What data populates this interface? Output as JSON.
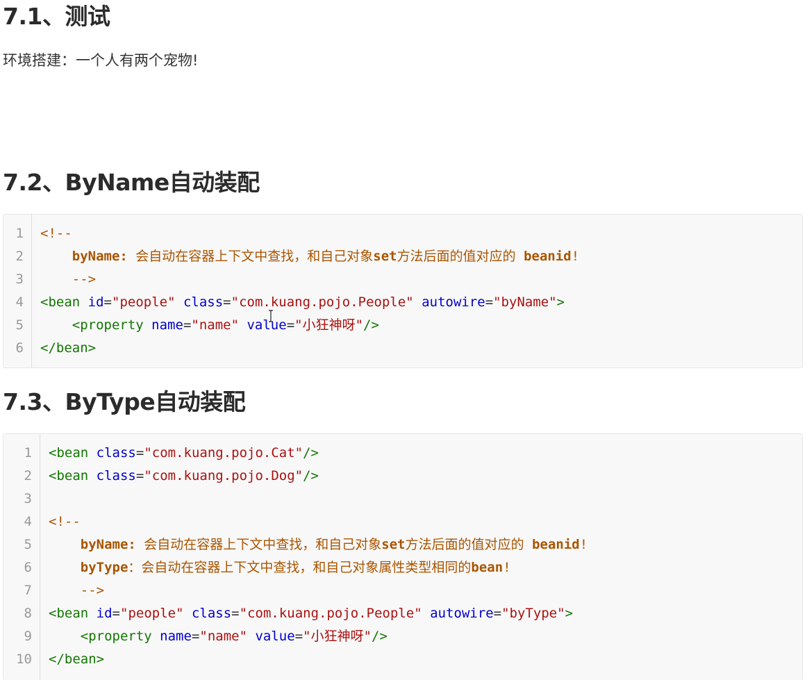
{
  "section1": {
    "heading": "7.1、测试",
    "paragraph": "环境搭建：一个人有两个宠物!"
  },
  "section2": {
    "heading": "7.2、ByName自动装配",
    "code": {
      "line_numbers": [
        "1",
        "2",
        "3",
        "4",
        "5",
        "6"
      ],
      "lines": [
        [
          {
            "t": "<!--",
            "c": "cmt"
          }
        ],
        [
          {
            "t": "    ",
            "c": "plain"
          },
          {
            "t": "byName:",
            "c": "cmtk"
          },
          {
            "t": " 会自动在容器上下文中查找，和自己对象",
            "c": "cmt"
          },
          {
            "t": "set",
            "c": "cmtk"
          },
          {
            "t": "方法后面的值对应的 ",
            "c": "cmt"
          },
          {
            "t": "beanid",
            "c": "cmtk"
          },
          {
            "t": "!",
            "c": "cmt"
          }
        ],
        [
          {
            "t": "    -->",
            "c": "cmt"
          }
        ],
        [
          {
            "t": "<bean",
            "c": "tag"
          },
          {
            "t": " ",
            "c": "plain"
          },
          {
            "t": "id",
            "c": "attr"
          },
          {
            "t": "=",
            "c": "plain"
          },
          {
            "t": "\"people\"",
            "c": "str"
          },
          {
            "t": " ",
            "c": "plain"
          },
          {
            "t": "class",
            "c": "attr"
          },
          {
            "t": "=",
            "c": "plain"
          },
          {
            "t": "\"com.kuang.pojo.People\"",
            "c": "str"
          },
          {
            "t": " ",
            "c": "plain"
          },
          {
            "t": "autowire",
            "c": "attr"
          },
          {
            "t": "=",
            "c": "plain"
          },
          {
            "t": "\"byName\"",
            "c": "str"
          },
          {
            "t": ">",
            "c": "tag"
          }
        ],
        [
          {
            "t": "    ",
            "c": "plain"
          },
          {
            "t": "<property",
            "c": "tag"
          },
          {
            "t": " ",
            "c": "plain"
          },
          {
            "t": "name",
            "c": "attr"
          },
          {
            "t": "=",
            "c": "plain"
          },
          {
            "t": "\"name\"",
            "c": "str"
          },
          {
            "t": " ",
            "c": "plain"
          },
          {
            "t": "value",
            "c": "attr"
          },
          {
            "t": "=",
            "c": "plain"
          },
          {
            "t": "\"小狂神呀\"",
            "c": "str"
          },
          {
            "t": "/>",
            "c": "tag"
          }
        ],
        [
          {
            "t": "</bean>",
            "c": "tag"
          }
        ]
      ]
    }
  },
  "section3": {
    "heading": "7.3、ByType自动装配",
    "code": {
      "line_numbers": [
        "1",
        "2",
        "3",
        "4",
        "5",
        "6",
        "7",
        "8",
        "9",
        "10"
      ],
      "lines": [
        [
          {
            "t": "<bean",
            "c": "tag"
          },
          {
            "t": " ",
            "c": "plain"
          },
          {
            "t": "class",
            "c": "attr"
          },
          {
            "t": "=",
            "c": "plain"
          },
          {
            "t": "\"com.kuang.pojo.Cat\"",
            "c": "str"
          },
          {
            "t": "/>",
            "c": "tag"
          }
        ],
        [
          {
            "t": "<bean",
            "c": "tag"
          },
          {
            "t": " ",
            "c": "plain"
          },
          {
            "t": "class",
            "c": "attr"
          },
          {
            "t": "=",
            "c": "plain"
          },
          {
            "t": "\"com.kuang.pojo.Dog\"",
            "c": "str"
          },
          {
            "t": "/>",
            "c": "tag"
          }
        ],
        [],
        [
          {
            "t": "<!--",
            "c": "cmt"
          }
        ],
        [
          {
            "t": "    ",
            "c": "plain"
          },
          {
            "t": "byName:",
            "c": "cmtk"
          },
          {
            "t": " 会自动在容器上下文中查找，和自己对象",
            "c": "cmt"
          },
          {
            "t": "set",
            "c": "cmtk"
          },
          {
            "t": "方法后面的值对应的 ",
            "c": "cmt"
          },
          {
            "t": "beanid",
            "c": "cmtk"
          },
          {
            "t": "!",
            "c": "cmt"
          }
        ],
        [
          {
            "t": "    ",
            "c": "plain"
          },
          {
            "t": "byType",
            "c": "cmtk"
          },
          {
            "t": "：会自动在容器上下文中查找，和自己对象属性类型相同的",
            "c": "cmt"
          },
          {
            "t": "bean",
            "c": "cmtk"
          },
          {
            "t": "!",
            "c": "cmt"
          }
        ],
        [
          {
            "t": "    -->",
            "c": "cmt"
          }
        ],
        [
          {
            "t": "<bean",
            "c": "tag"
          },
          {
            "t": " ",
            "c": "plain"
          },
          {
            "t": "id",
            "c": "attr"
          },
          {
            "t": "=",
            "c": "plain"
          },
          {
            "t": "\"people\"",
            "c": "str"
          },
          {
            "t": " ",
            "c": "plain"
          },
          {
            "t": "class",
            "c": "attr"
          },
          {
            "t": "=",
            "c": "plain"
          },
          {
            "t": "\"com.kuang.pojo.People\"",
            "c": "str"
          },
          {
            "t": " ",
            "c": "plain"
          },
          {
            "t": "autowire",
            "c": "attr"
          },
          {
            "t": "=",
            "c": "plain"
          },
          {
            "t": "\"byType\"",
            "c": "str"
          },
          {
            "t": ">",
            "c": "tag"
          }
        ],
        [
          {
            "t": "    ",
            "c": "plain"
          },
          {
            "t": "<property",
            "c": "tag"
          },
          {
            "t": " ",
            "c": "plain"
          },
          {
            "t": "name",
            "c": "attr"
          },
          {
            "t": "=",
            "c": "plain"
          },
          {
            "t": "\"name\"",
            "c": "str"
          },
          {
            "t": " ",
            "c": "plain"
          },
          {
            "t": "value",
            "c": "attr"
          },
          {
            "t": "=",
            "c": "plain"
          },
          {
            "t": "\"小狂神呀\"",
            "c": "str"
          },
          {
            "t": "/>",
            "c": "tag"
          }
        ],
        [
          {
            "t": "</bean>",
            "c": "tag"
          }
        ]
      ]
    }
  },
  "colors": {
    "tag": "#117700",
    "attribute": "#0000cc",
    "string": "#aa1111",
    "comment": "#aa5500",
    "code_background": "#f8f8f8"
  },
  "icons": {
    "cursor": "text-cursor-icon"
  }
}
